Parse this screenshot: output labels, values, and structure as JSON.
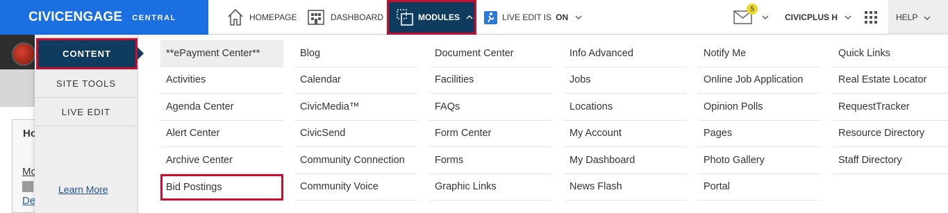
{
  "brand": {
    "name": "CIVICENGAGE",
    "sub": "CENTRAL",
    "color": "#1c6fe0"
  },
  "nav": {
    "homepage": "HOMEPAGE",
    "dashboard": "DASHBOARD",
    "modules": "MODULES",
    "live_edit_prefix": "LIVE EDIT IS",
    "live_edit_state": "ON",
    "notifications_count": "5",
    "user": "CIVICPLUS H",
    "help": "HELP"
  },
  "background": {
    "ho": "Ho",
    "mo": "Mo",
    "de": "De"
  },
  "sidebar": {
    "items": [
      {
        "label": "CONTENT",
        "active": true
      },
      {
        "label": "SITE TOOLS",
        "active": false
      },
      {
        "label": "LIVE EDIT",
        "active": false
      }
    ],
    "learn_more": "Learn More"
  },
  "modules": {
    "columns": [
      [
        "**ePayment Center**",
        "Activities",
        "Agenda Center",
        "Alert Center",
        "Archive Center",
        "Bid Postings"
      ],
      [
        "Blog",
        "Calendar",
        "CivicMedia™",
        "CivicSend",
        "Community Connection",
        "Community Voice"
      ],
      [
        "Document Center",
        "Facilities",
        "FAQs",
        "Form Center",
        "Forms",
        "Graphic Links"
      ],
      [
        "Info Advanced",
        "Jobs",
        "Locations",
        "My Account",
        "My Dashboard",
        "News Flash"
      ],
      [
        "Notify Me",
        "Online Job Application",
        "Opinion Polls",
        "Pages",
        "Photo Gallery",
        "Portal"
      ],
      [
        "Quick Links",
        "Real Estate Locator",
        "RequestTracker",
        "Resource Directory",
        "Staff Directory"
      ]
    ]
  },
  "colors": {
    "navy": "#0f3b5f",
    "highlight_border": "#c8102e"
  }
}
